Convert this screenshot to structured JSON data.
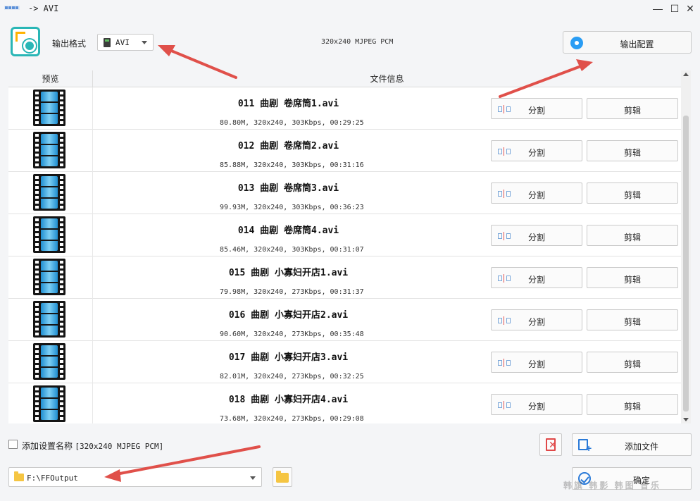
{
  "window": {
    "title": "-> AVI",
    "controls": [
      "minimize",
      "maximize",
      "close"
    ]
  },
  "toolbar": {
    "format_label": "输出格式",
    "format_value": "AVI",
    "format_info": "320x240 MJPEG PCM",
    "config_button": "输出配置"
  },
  "table": {
    "headers": {
      "preview": "预览",
      "info": "文件信息"
    },
    "split_label": "分割",
    "edit_label": "剪辑",
    "rows": [
      {
        "name": "011 曲剧 卷席筒1.avi",
        "meta": "80.80M, 320x240, 303Kbps, 00:29:25"
      },
      {
        "name": "012 曲剧 卷席筒2.avi",
        "meta": "85.88M, 320x240, 303Kbps, 00:31:16"
      },
      {
        "name": "013 曲剧 卷席筒3.avi",
        "meta": "99.93M, 320x240, 303Kbps, 00:36:23"
      },
      {
        "name": "014 曲剧 卷席筒4.avi",
        "meta": "85.46M, 320x240, 303Kbps, 00:31:07"
      },
      {
        "name": "015 曲剧 小寡妇开店1.avi",
        "meta": "79.98M, 320x240, 273Kbps, 00:31:37"
      },
      {
        "name": "016 曲剧 小寡妇开店2.avi",
        "meta": "90.60M, 320x240, 273Kbps, 00:35:48"
      },
      {
        "name": "017 曲剧 小寡妇开店3.avi",
        "meta": "82.01M, 320x240, 273Kbps, 00:32:25"
      },
      {
        "name": "018 曲剧 小寡妇开店4.avi",
        "meta": "73.68M, 320x240, 273Kbps, 00:29:08"
      }
    ]
  },
  "bottom": {
    "add_name_label": "添加设置名称",
    "add_name_info": "[320x240 MJPEG PCM]",
    "add_name_checked": false,
    "add_files_button": "添加文件",
    "output_path": "F:\\FFOutput",
    "ok_button": "确定",
    "watermark": "韩旗 韩影 韩图 音乐"
  },
  "colors": {
    "accent_teal": "#29b6b6",
    "accent_blue": "#2a9df4",
    "arrow_red": "#e0504a",
    "folder_yellow": "#f5c542"
  }
}
